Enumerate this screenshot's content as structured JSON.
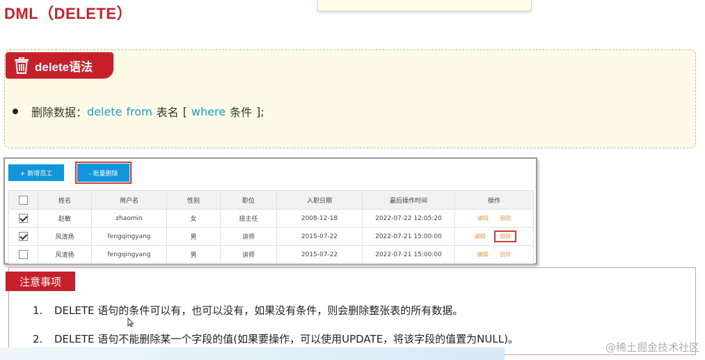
{
  "title": "DML（DELETE）",
  "syntax": {
    "tag": "delete语法",
    "icon": "trash-icon",
    "prefix": "删除数据：",
    "kw_delete": "delete",
    "kw_from": "from",
    "table_name": "表名",
    "bracket_open": "[",
    "kw_where": "where",
    "condition": "条件",
    "bracket_close": "];"
  },
  "panel": {
    "add_button": "+ 新增员工",
    "batch_delete_button": "- 批量删除",
    "columns": [
      "姓名",
      "用户名",
      "性别",
      "职位",
      "入职日期",
      "最后操作时间",
      "操作"
    ],
    "rows": [
      {
        "checked": true,
        "name": "赵敏",
        "username": "zhaomin",
        "gender": "女",
        "position": "班主任",
        "entry_date": "2008-12-18",
        "last_op": "2022-07-22 12:05:20",
        "edit": "编辑",
        "delete": "删除"
      },
      {
        "checked": true,
        "name": "风清扬",
        "username": "fengqingyang",
        "gender": "男",
        "position": "讲师",
        "entry_date": "2015-07-22",
        "last_op": "2022-07-21 15:00:00",
        "edit": "编辑",
        "delete": "删除"
      },
      {
        "checked": false,
        "name": "风清扬",
        "username": "fengqingyang",
        "gender": "男",
        "position": "讲师",
        "entry_date": "2015-07-22",
        "last_op": "2022-07-21 15:00:00",
        "edit": "编辑",
        "delete": "删除"
      }
    ]
  },
  "notes": {
    "tag": "注意事项",
    "items": [
      {
        "num": "1.",
        "text": "DELETE 语句的条件可以有，也可以没有，如果没有条件，则会删除整张表的所有数据。"
      },
      {
        "num": "2.",
        "text": "DELETE 语句不能删除某一个字段的值(如果要操作，可以使用UPDATE，将该字段的值置为NULL)。"
      }
    ]
  },
  "watermark": "@稀土掘金技术社区",
  "colors": {
    "accent_red": "#c8202b",
    "keyword_blue": "#1a9ad6",
    "button_blue": "#1296db",
    "op_orange": "#f0a040"
  }
}
